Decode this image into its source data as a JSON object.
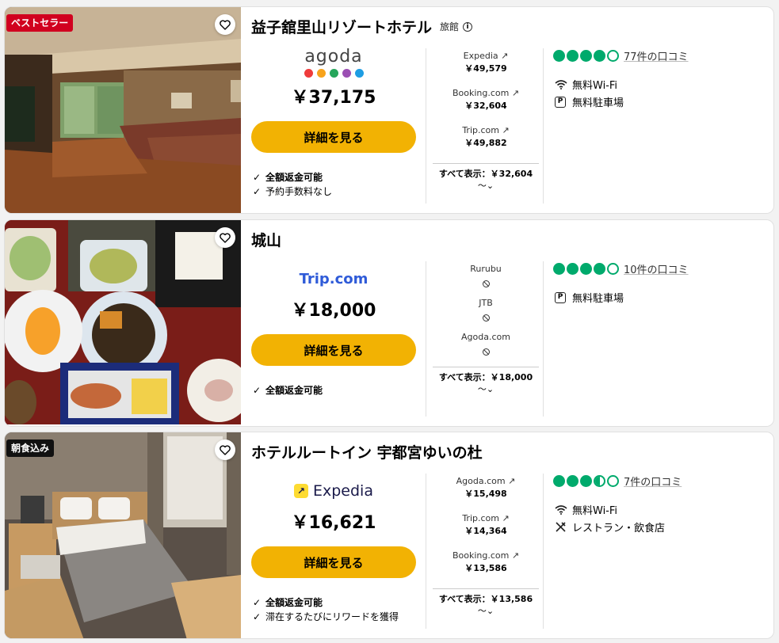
{
  "cards": [
    {
      "badge": "ベストセラー",
      "name": "益子舘里山リゾートホテル",
      "type_label": "旅館",
      "main_provider": "agoda",
      "main_price": "￥37,175",
      "cta": "詳細を見る",
      "features": [
        "全額返金可能",
        "予約手数料なし"
      ],
      "others": [
        {
          "name": "Expedia",
          "price": "￥49,579"
        },
        {
          "name": "Booking.com",
          "price": "￥32,604"
        },
        {
          "name": "Trip.com",
          "price": "￥49,882"
        }
      ],
      "show_all": "すべて表示：￥32,604",
      "rating": 4,
      "reviews": "77件の口コミ",
      "amenities": [
        {
          "icon": "wifi-icon",
          "label": "無料Wi-Fi"
        },
        {
          "icon": "parking-icon",
          "label": "無料駐車場"
        }
      ]
    },
    {
      "name": "城山",
      "main_provider": "Trip.com",
      "main_price": "￥18,000",
      "cta": "詳細を見る",
      "features": [
        "全額返金可能"
      ],
      "others": [
        {
          "name": "Rurubu"
        },
        {
          "name": "JTB"
        },
        {
          "name": "Agoda.com"
        }
      ],
      "show_all": "すべて表示：￥18,000",
      "rating": 4,
      "reviews": "10件の口コミ",
      "amenities": [
        {
          "icon": "parking-icon",
          "label": "無料駐車場"
        }
      ]
    },
    {
      "badge": "朝食込み",
      "name": "ホテルルートイン 宇都宮ゆいの杜",
      "main_provider": "Expedia",
      "main_price": "￥16,621",
      "cta": "詳細を見る",
      "features": [
        "全額返金可能",
        "滞在するたびにリワードを獲得"
      ],
      "others": [
        {
          "name": "Agoda.com",
          "price": "￥15,498"
        },
        {
          "name": "Trip.com",
          "price": "￥14,364"
        },
        {
          "name": "Booking.com",
          "price": "￥13,586"
        }
      ],
      "show_all": "すべて表示：￥13,586",
      "rating": 3.5,
      "reviews": "7件の口コミ",
      "amenities": [
        {
          "icon": "wifi-icon",
          "label": "無料Wi-Fi"
        },
        {
          "icon": "restaurant-icon",
          "label": "レストラン・飲食店"
        }
      ]
    }
  ],
  "colors": {
    "cta": "#f2b203",
    "rating": "#00aa6c",
    "badge_red": "#d1001f"
  }
}
